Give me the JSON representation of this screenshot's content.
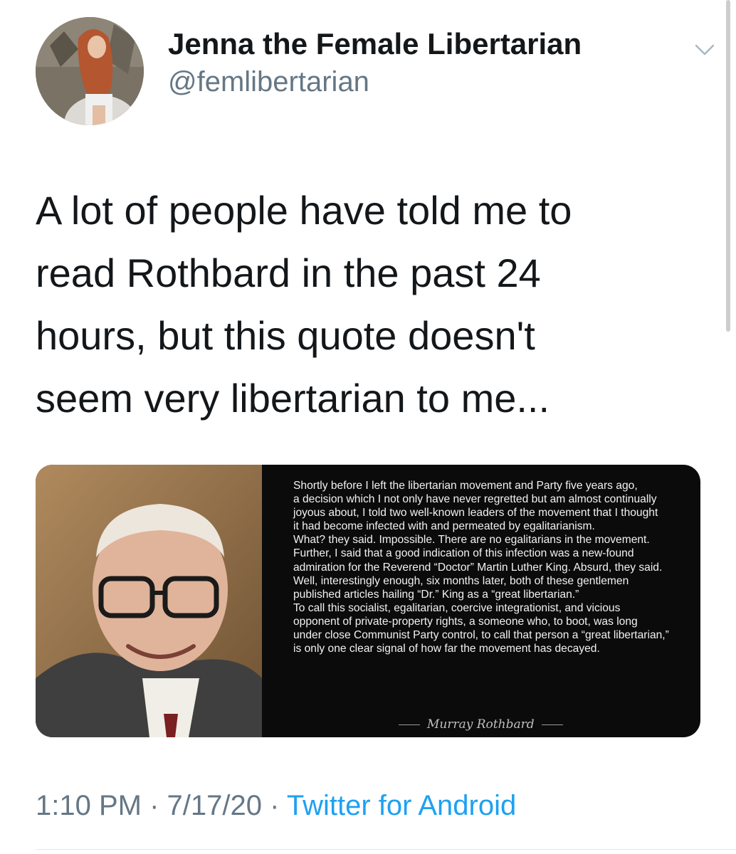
{
  "user": {
    "display_name": "Jenna the Female Libertarian",
    "handle": "@femlibertarian",
    "avatar_icon": "profile-photo"
  },
  "tweet": {
    "text": "A lot of people have told me to read Rothbard in the past 24 hours, but this quote doesn't seem very libertarian to me...",
    "text_lines": [
      "A lot of people have told me to",
      "read Rothbard in the past 24",
      "hours, but this quote doesn't",
      "seem very libertarian to me..."
    ]
  },
  "media": {
    "quote_lines": [
      "Shortly before I left the libertarian movement and Party five years ago,",
      "a decision which I not only have never regretted but am almost continually",
      "joyous about, I told two well-known leaders of the movement that I thought",
      "it had become infected with and permeated by egalitarianism.",
      "What? they said. Impossible. There are no egalitarians in the movement.",
      "Further, I said that a good indication of this infection was a new-found",
      "admiration for the Reverend “Doctor” Martin Luther King. Absurd, they said.",
      "Well, interestingly enough, six months later, both of these gentlemen",
      "published articles hailing “Dr.” King as a “great libertarian.”",
      "To call this socialist, egalitarian, coercive integrationist, and vicious",
      "opponent of private-property rights, a someone who, to boot, was long",
      "under close Communist Party control, to call that person a “great libertarian,”",
      "is only one clear signal of how far the movement has decayed."
    ],
    "attribution": "Murray Rothbard"
  },
  "meta": {
    "time": "1:10 PM",
    "separator": "·",
    "date": "7/17/20",
    "source": "Twitter for Android"
  },
  "colors": {
    "text": "#14171a",
    "secondary": "#657786",
    "link": "#1da1f2"
  },
  "icons": {
    "menu": "chevron-down-icon"
  }
}
